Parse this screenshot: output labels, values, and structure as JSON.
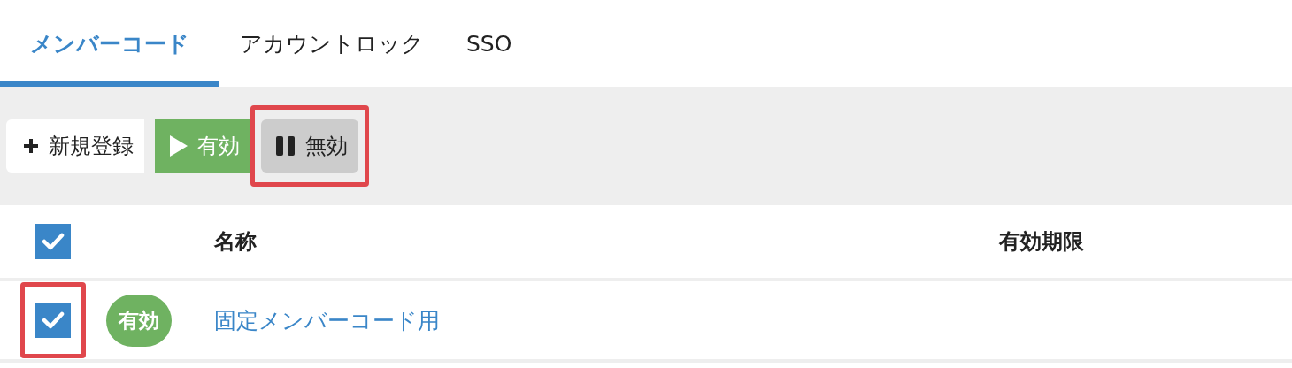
{
  "tabs": [
    {
      "label": "メンバーコード",
      "selected": true
    },
    {
      "label": "アカウントロック",
      "selected": false
    },
    {
      "label": "SSO",
      "selected": false
    }
  ],
  "toolbar": {
    "buttons": [
      {
        "kind": "add",
        "label": "新規登録",
        "highlighted": false
      },
      {
        "kind": "enable",
        "label": "有効",
        "highlighted": false
      },
      {
        "kind": "disable",
        "label": "無効",
        "highlighted": true
      }
    ]
  },
  "table": {
    "select_all": {
      "checked": true
    },
    "columns": [
      "名称",
      "有効期限"
    ],
    "rows": [
      {
        "checked": true,
        "highlighted": true,
        "status": "有効",
        "active": true,
        "name": "固定メンバーコード用"
      }
    ]
  }
}
